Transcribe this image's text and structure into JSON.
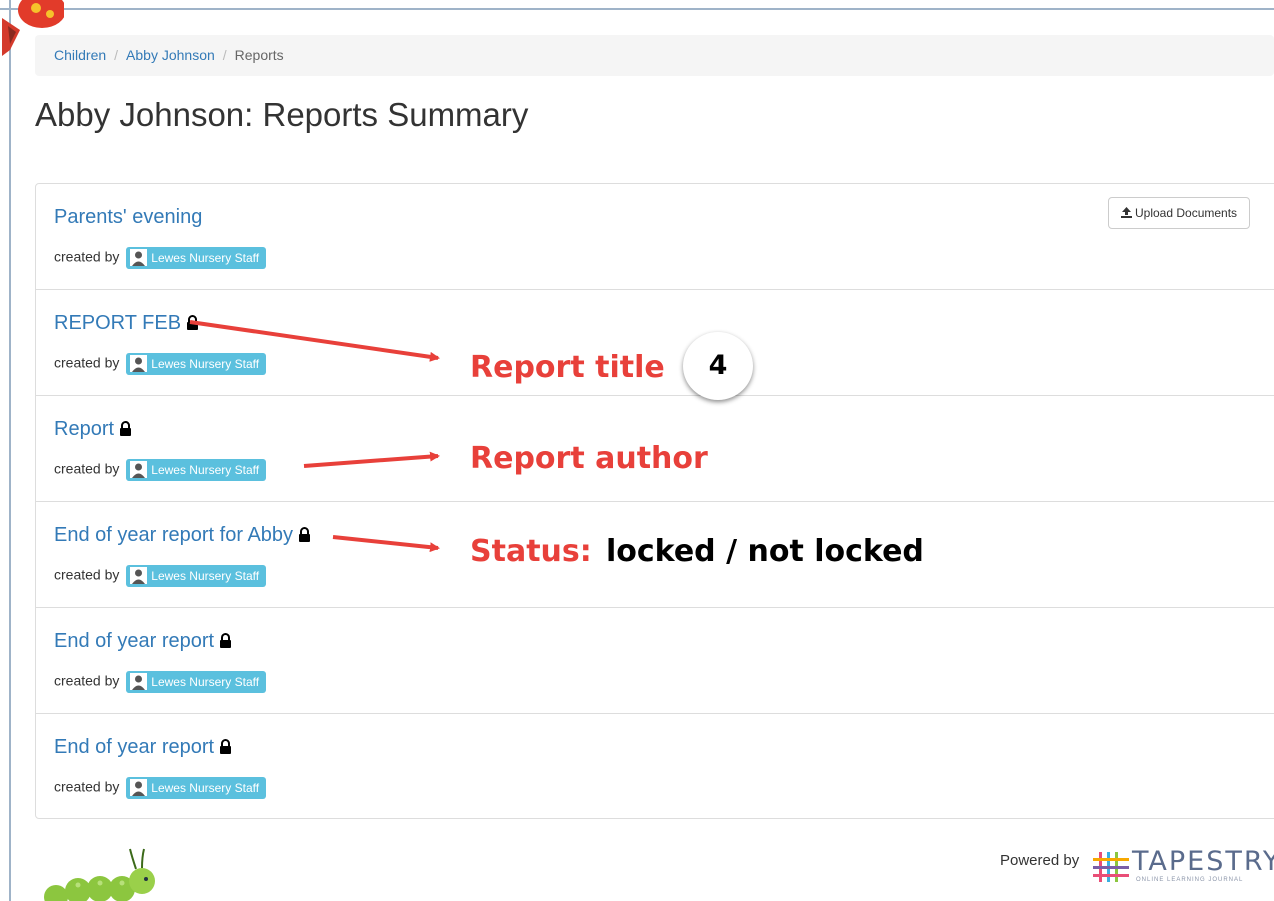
{
  "breadcrumb": {
    "items": [
      "Children",
      "Abby Johnson"
    ],
    "active": "Reports",
    "separator": "/"
  },
  "page": {
    "title": "Abby Johnson: Reports Summary"
  },
  "toolbar": {
    "upload_label": "Upload Documents",
    "upload_icon": "upload-icon"
  },
  "reports": [
    {
      "title": "Parents' evening",
      "locked": false,
      "created_by_label": "created by",
      "author": "Lewes Nursery Staff"
    },
    {
      "title": "REPORT FEB",
      "locked": true,
      "created_by_label": "created by",
      "author": "Lewes Nursery Staff"
    },
    {
      "title": "Report",
      "locked": true,
      "created_by_label": "created by",
      "author": "Lewes Nursery Staff"
    },
    {
      "title": "End of year report for Abby",
      "locked": true,
      "created_by_label": "created by",
      "author": "Lewes Nursery Staff"
    },
    {
      "title": "End of year report",
      "locked": true,
      "created_by_label": "created by",
      "author": "Lewes Nursery Staff"
    },
    {
      "title": "End of year report",
      "locked": true,
      "created_by_label": "created by",
      "author": "Lewes Nursery Staff"
    }
  ],
  "annotations": {
    "title_label": "Report title",
    "step_number": "4",
    "author_label": "Report author",
    "status_label": "Status:",
    "status_value": "locked / not locked",
    "color": "#e8403a"
  },
  "footer": {
    "powered_by": "Powered by",
    "brand": "TAPESTRY",
    "tagline": "ONLINE LEARNING JOURNAL"
  },
  "colors": {
    "link": "#337ab7",
    "badge": "#5bc0de",
    "annotation": "#e8403a"
  }
}
